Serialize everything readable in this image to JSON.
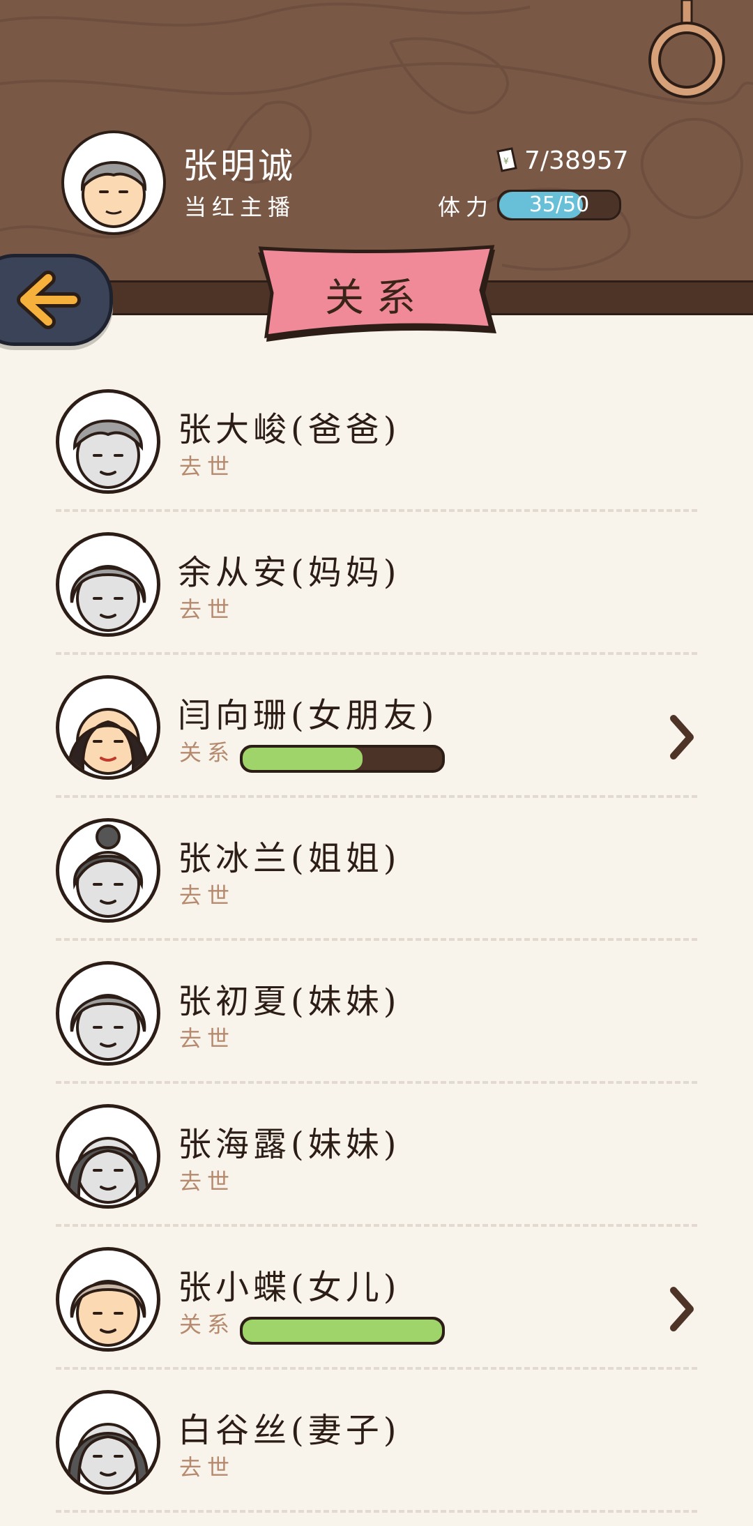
{
  "player": {
    "name": "张明诚",
    "title": "当红主播",
    "money": "7/38957",
    "money_icon": "banknote-icon",
    "stamina_label": "体力",
    "stamina_value": "35/50",
    "stamina_current": 35,
    "stamina_max": 50
  },
  "header": {
    "title": "关系",
    "back_icon": "back-arrow-icon"
  },
  "colors": {
    "wood": "#7a5846",
    "banner": "#f08a99",
    "stamina": "#67c0d8",
    "relationship": "#9ed46a",
    "deceased_text": "#b58a6e"
  },
  "relationships": [
    {
      "name": "张大峻(爸爸)",
      "status": "去世",
      "alive": false,
      "avatar": "elderly-man"
    },
    {
      "name": "余从安(妈妈)",
      "status": "去世",
      "alive": false,
      "avatar": "elderly-woman"
    },
    {
      "name": "闫向珊(女朋友)",
      "status": "关系",
      "alive": true,
      "level": 0.6,
      "avatar": "young-woman-long-hair"
    },
    {
      "name": "张冰兰(姐姐)",
      "status": "去世",
      "alive": false,
      "avatar": "woman-bun"
    },
    {
      "name": "张初夏(妹妹)",
      "status": "去世",
      "alive": false,
      "avatar": "elderly-woman"
    },
    {
      "name": "张海露(妹妹)",
      "status": "去世",
      "alive": false,
      "avatar": "woman-bob"
    },
    {
      "name": "张小蝶(女儿)",
      "status": "关系",
      "alive": true,
      "level": 1.0,
      "avatar": "elderly-woman"
    },
    {
      "name": "白谷丝(妻子)",
      "status": "去世",
      "alive": false,
      "avatar": "woman-bob"
    }
  ]
}
